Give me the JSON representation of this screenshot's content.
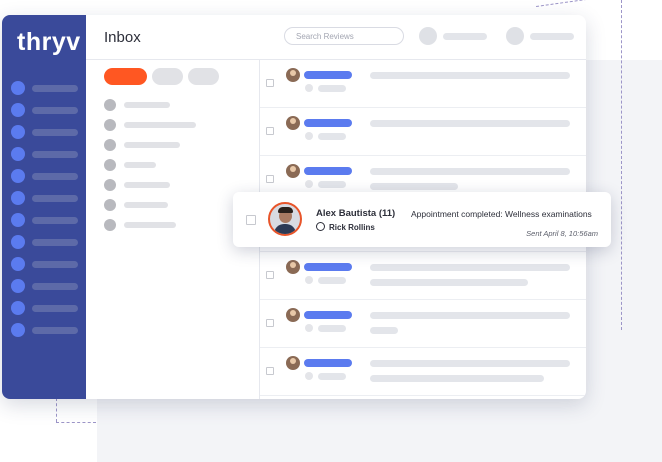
{
  "app": {
    "logo_text": "thryv",
    "title": "Inbox"
  },
  "search": {
    "placeholder": "Search Reviews"
  },
  "colors": {
    "sidebar": "#3a4a9a",
    "accent_orange": "#ff5722",
    "accent_blue": "#5b7bef"
  },
  "card": {
    "name": "Alex Bautista (11)",
    "assignee": "Rick Rollins",
    "message": "Appointment completed: Wellness examinations",
    "time": "Sent April 8, 10:56am"
  }
}
